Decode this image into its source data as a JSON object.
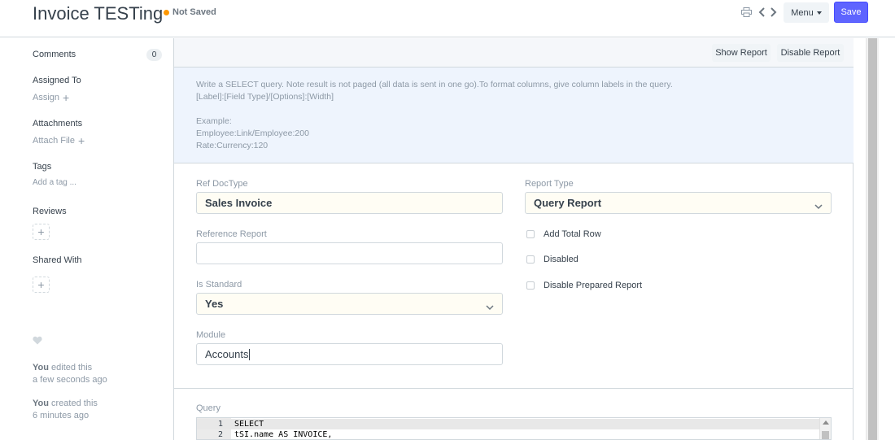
{
  "header": {
    "title": "Invoice TESTing",
    "status": "Not Saved",
    "status_color": "#ff9800",
    "icons": [
      "print-icon",
      "chevron-left-icon",
      "chevron-right-icon"
    ],
    "menu_label": "Menu",
    "save_label": "Save",
    "accent_color": "#5e64ff"
  },
  "sidebar": {
    "comments_label": "Comments",
    "comments_count": "0",
    "assigned_to_label": "Assigned To",
    "assign_link": "Assign",
    "attachments_label": "Attachments",
    "attach_link": "Attach File",
    "tags_label": "Tags",
    "add_tag_link": "Add a tag ...",
    "reviews_label": "Reviews",
    "shared_with_label": "Shared With",
    "activity": [
      {
        "actor": "You",
        "action": "edited this",
        "time": "a few seconds ago"
      },
      {
        "actor": "You",
        "action": "created this",
        "time": "6 minutes ago"
      }
    ]
  },
  "toolbar": {
    "show_report": "Show Report",
    "disable_report": "Disable Report"
  },
  "help": {
    "lines": [
      "Write a SELECT query. Note result is not paged (all data is sent in one go).To format columns, give column labels in the query.",
      "[Label]:[Field Type]/[Options]:[Width]",
      "",
      "Example:",
      "Employee:Link/Employee:200",
      "Rate:Currency:120"
    ]
  },
  "form": {
    "ref_doctype": {
      "label": "Ref DocType",
      "value": "Sales Invoice"
    },
    "reference_report": {
      "label": "Reference Report",
      "value": ""
    },
    "is_standard": {
      "label": "Is Standard",
      "value": "Yes"
    },
    "module": {
      "label": "Module",
      "value": "Accounts"
    },
    "report_type": {
      "label": "Report Type",
      "value": "Query Report"
    },
    "checkboxes": {
      "add_total_row": "Add Total Row",
      "disabled": "Disabled",
      "disable_prepared_report": "Disable Prepared Report"
    }
  },
  "query": {
    "label": "Query",
    "lines": [
      {
        "num": "1",
        "text": "SELECT"
      },
      {
        "num": "2",
        "text": "tSI.name AS INVOICE,"
      }
    ]
  }
}
